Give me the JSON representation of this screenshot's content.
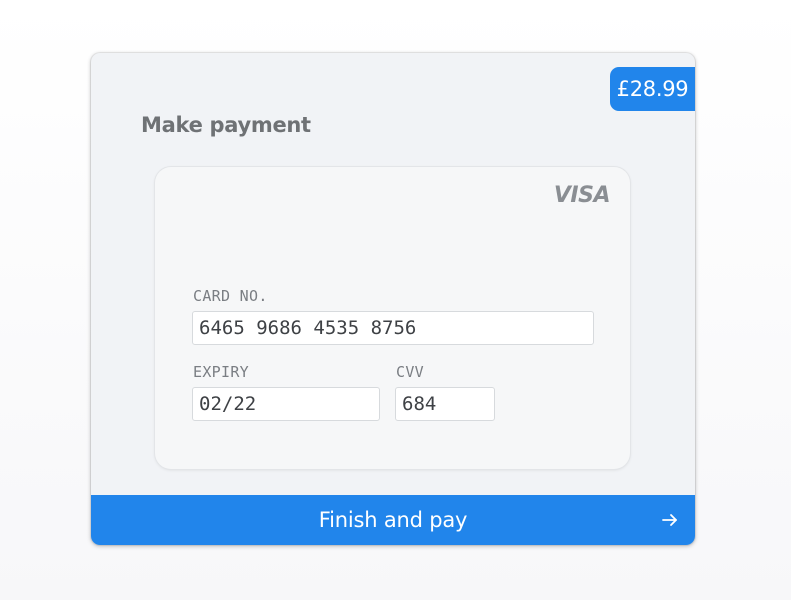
{
  "payment": {
    "title": "Make payment",
    "price": "£28.99",
    "card": {
      "brand": "VISA",
      "card_no_label": "CARD NO.",
      "card_no_value": "6465 9686 4535 8756",
      "expiry_label": "EXPIRY",
      "expiry_value": "02/22",
      "cvv_label": "CVV",
      "cvv_value": "684"
    },
    "submit_label": "Finish and pay",
    "submit_icon": "arrow-right-icon"
  },
  "colors": {
    "accent": "#2185eb",
    "panel_background": "#f1f3f6",
    "card_background": "#f6f7f8",
    "muted_text": "#6f7275"
  }
}
